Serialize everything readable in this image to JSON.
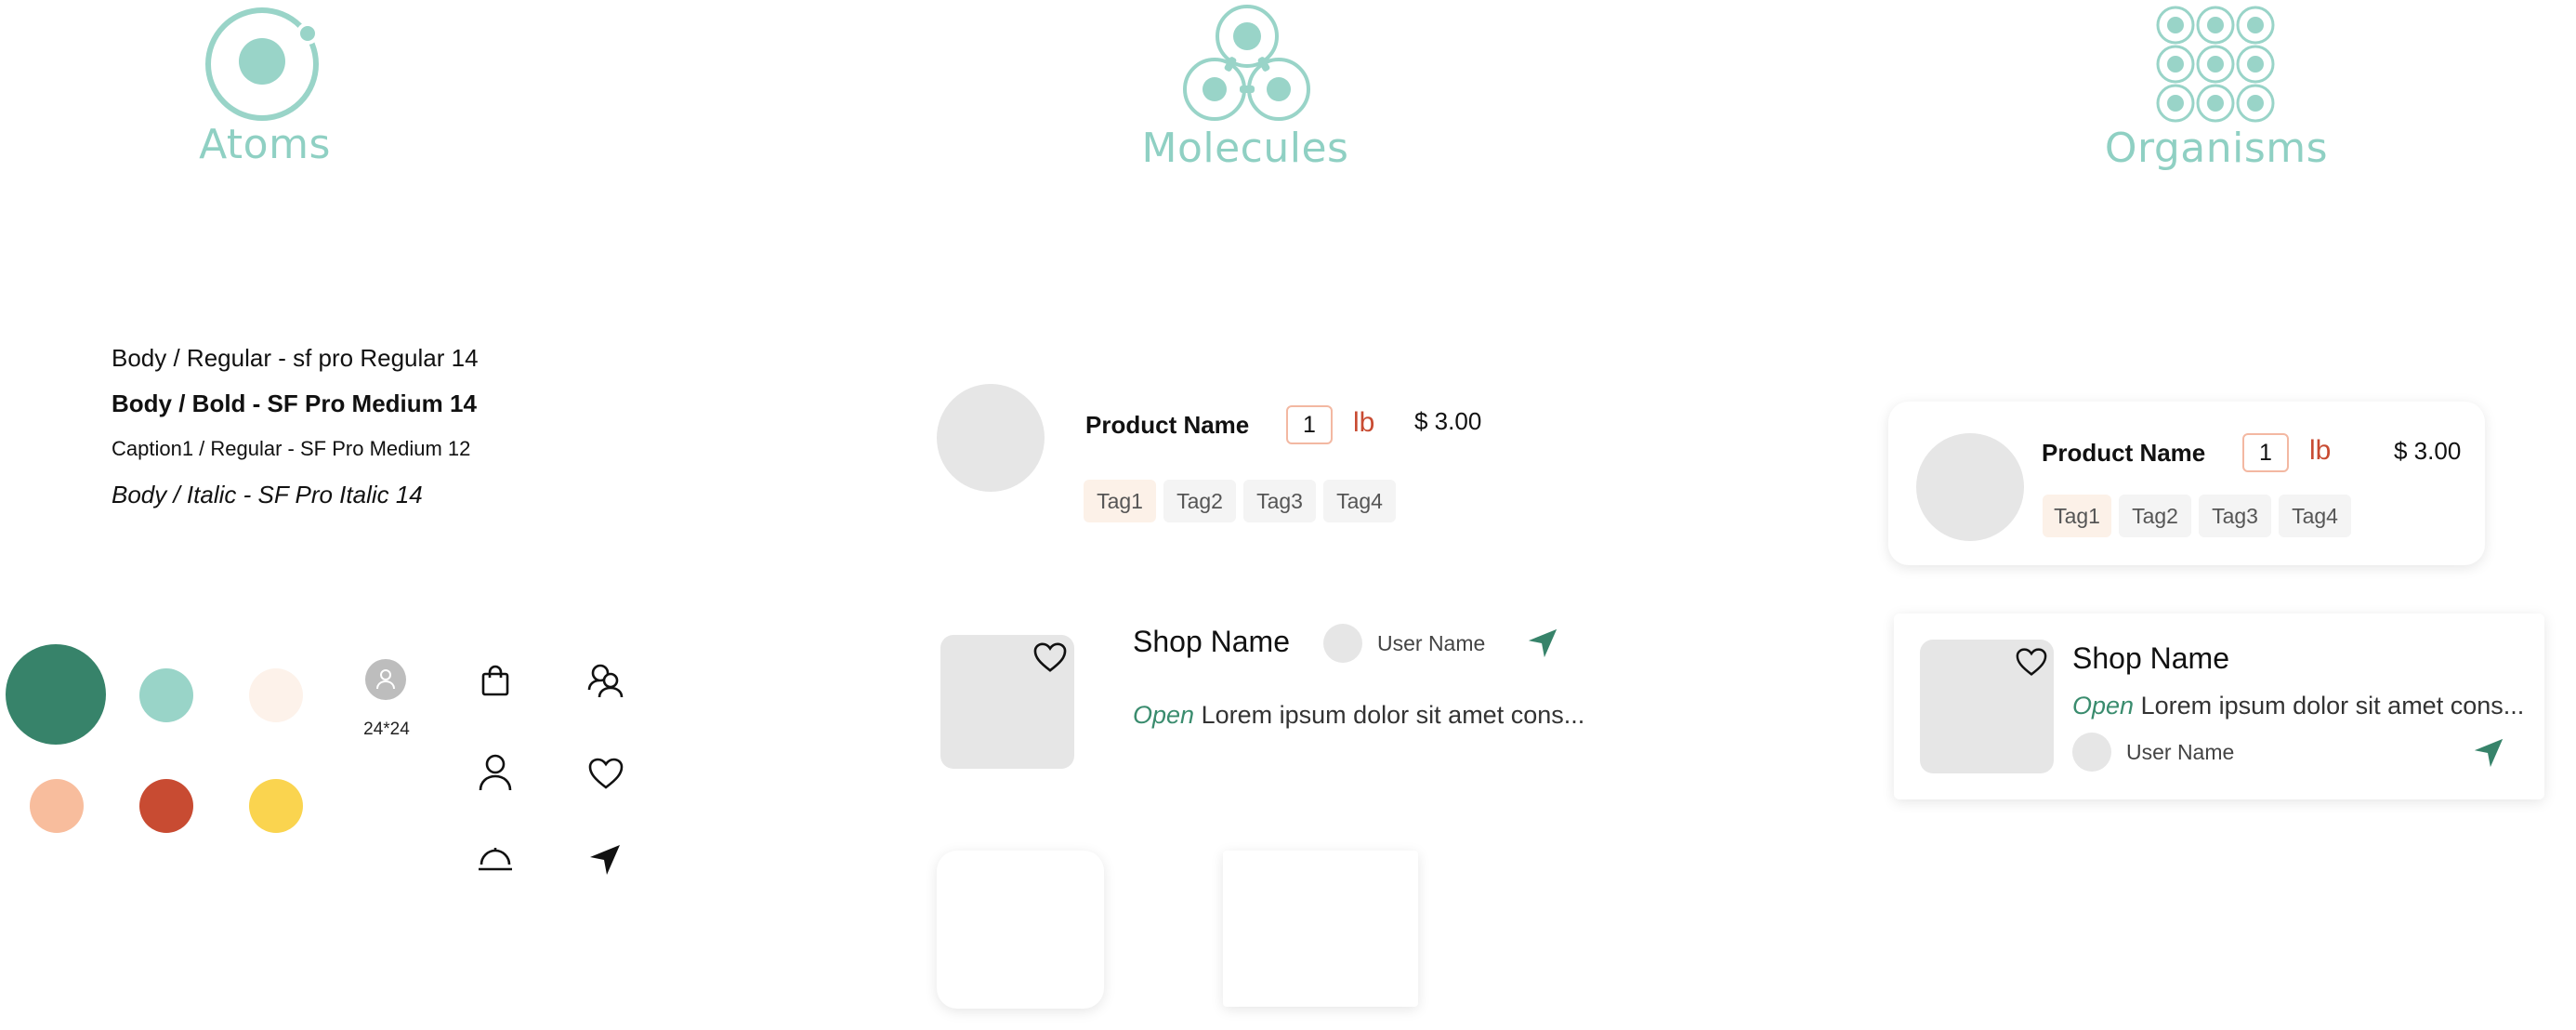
{
  "headers": {
    "atoms": "Atoms",
    "molecules": "Molecules",
    "organisms": "Organisms"
  },
  "typography": {
    "body_regular": "Body / Regular - sf pro Regular 14",
    "body_bold": "Body / Bold - SF Pro Medium 14",
    "caption": "Caption1 / Regular -  SF Pro Medium 12",
    "body_italic": "Body / Italic - SF Pro Italic 14"
  },
  "palette": {
    "primary_dark": "#37836a",
    "mint": "#99d4c8",
    "cream": "#fdf2ea",
    "peach": "#f8bd9d",
    "rust": "#c84b32",
    "yellow": "#fad44f",
    "grey_avatar": "#bdbdbd"
  },
  "avatar_size_label": "24*24",
  "icons": [
    "shopping-bag-icon",
    "users-icon",
    "user-icon",
    "heart-icon",
    "cloche-icon",
    "navigation-arrow-icon"
  ],
  "product": {
    "name": "Product Name",
    "quantity": "1",
    "unit": "lb",
    "price": "$ 3.00",
    "tags": [
      "Tag1",
      "Tag2",
      "Tag3",
      "Tag4"
    ]
  },
  "shop": {
    "name": "Shop Name",
    "user_name": "User Name",
    "open_label": "Open",
    "description": "Lorem ipsum dolor sit amet cons..."
  }
}
